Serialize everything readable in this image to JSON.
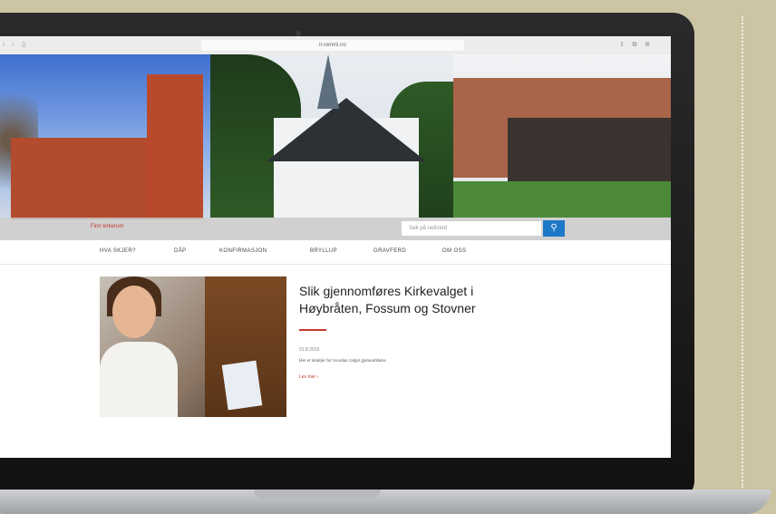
{
  "browser": {
    "url": "ir.rommi.no",
    "left_buttons": "‹ ›  ▯",
    "right_buttons": "⇧  ⧉  ⊕"
  },
  "hero": {
    "find_link": "Finn kirkerum",
    "search_placeholder": "Søk på nettsted",
    "search_icon": "magnifier-icon"
  },
  "nav": {
    "items": [
      "HVA SKJER?",
      "DÅP",
      "KONFIRMASJON",
      "BRYLLUP",
      "GRAVFERD",
      "OM OSS"
    ]
  },
  "article": {
    "title": "Slik gjennomføres  Kirkevalget i Høybråten, Fossum og Stovner",
    "date": "01.8.2019",
    "description": "Her er detaljer for hvordan valget gjennomføres",
    "read_more": "Les mer  ›"
  },
  "colors": {
    "accent": "#c0392b",
    "search_button": "#1e78c8",
    "background": "#cdc4a4"
  }
}
